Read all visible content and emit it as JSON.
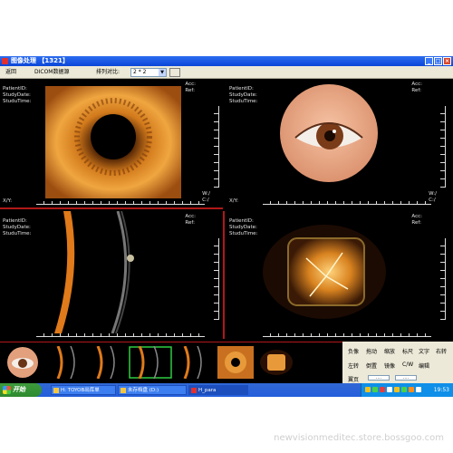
{
  "window": {
    "title": "图像处理 【1321】",
    "min": "_",
    "max": "□",
    "close": "×"
  },
  "toolbar": {
    "back": "返回",
    "dicom": "DICOM数据源",
    "sort_label": "排列对比:",
    "layout_value": "2 * 2"
  },
  "panel_meta": {
    "patient": "PatientID:",
    "study_date": "StudyDate:",
    "study_time": "StuduTime:",
    "acc": "Acc:",
    "ref": "Ref:",
    "xy": "X/Y:",
    "w": "W:/",
    "c": "C:/"
  },
  "right_panel": {
    "buttons": [
      "负像",
      "拖动",
      "缩放",
      "标尺",
      "文字",
      "右转",
      "左转",
      "倒置",
      "镜像",
      "C/W",
      "编辑"
    ],
    "page_label": "翼页",
    "slots": [
      "....",
      "...."
    ]
  },
  "taskbar": {
    "start": "开始",
    "tasks": [
      "H: TOYOB出库单",
      "未存档盘 (D:)",
      "H_para"
    ],
    "clock": "19:53"
  },
  "watermark": "newvisionmeditec.store.bossgoo.com"
}
